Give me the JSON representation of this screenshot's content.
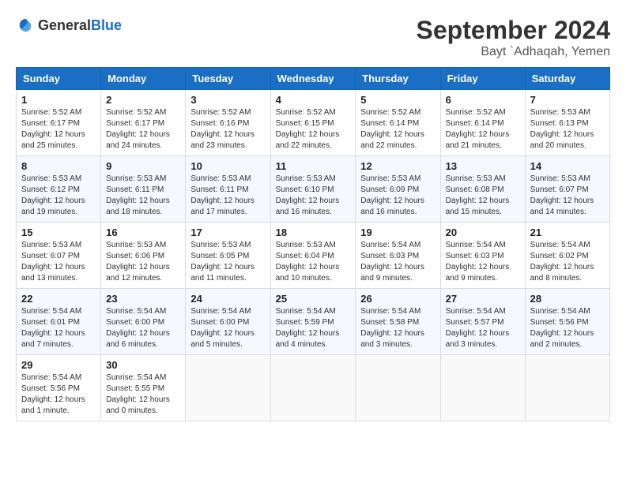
{
  "header": {
    "logo_general": "General",
    "logo_blue": "Blue",
    "month": "September 2024",
    "location": "Bayt `Adhaqah, Yemen"
  },
  "weekdays": [
    "Sunday",
    "Monday",
    "Tuesday",
    "Wednesday",
    "Thursday",
    "Friday",
    "Saturday"
  ],
  "weeks": [
    [
      {
        "day": "1",
        "sunrise": "5:52 AM",
        "sunset": "6:17 PM",
        "daylight": "12 hours and 25 minutes."
      },
      {
        "day": "2",
        "sunrise": "5:52 AM",
        "sunset": "6:17 PM",
        "daylight": "12 hours and 24 minutes."
      },
      {
        "day": "3",
        "sunrise": "5:52 AM",
        "sunset": "6:16 PM",
        "daylight": "12 hours and 23 minutes."
      },
      {
        "day": "4",
        "sunrise": "5:52 AM",
        "sunset": "6:15 PM",
        "daylight": "12 hours and 22 minutes."
      },
      {
        "day": "5",
        "sunrise": "5:52 AM",
        "sunset": "6:14 PM",
        "daylight": "12 hours and 22 minutes."
      },
      {
        "day": "6",
        "sunrise": "5:52 AM",
        "sunset": "6:14 PM",
        "daylight": "12 hours and 21 minutes."
      },
      {
        "day": "7",
        "sunrise": "5:53 AM",
        "sunset": "6:13 PM",
        "daylight": "12 hours and 20 minutes."
      }
    ],
    [
      {
        "day": "8",
        "sunrise": "5:53 AM",
        "sunset": "6:12 PM",
        "daylight": "12 hours and 19 minutes."
      },
      {
        "day": "9",
        "sunrise": "5:53 AM",
        "sunset": "6:11 PM",
        "daylight": "12 hours and 18 minutes."
      },
      {
        "day": "10",
        "sunrise": "5:53 AM",
        "sunset": "6:11 PM",
        "daylight": "12 hours and 17 minutes."
      },
      {
        "day": "11",
        "sunrise": "5:53 AM",
        "sunset": "6:10 PM",
        "daylight": "12 hours and 16 minutes."
      },
      {
        "day": "12",
        "sunrise": "5:53 AM",
        "sunset": "6:09 PM",
        "daylight": "12 hours and 16 minutes."
      },
      {
        "day": "13",
        "sunrise": "5:53 AM",
        "sunset": "6:08 PM",
        "daylight": "12 hours and 15 minutes."
      },
      {
        "day": "14",
        "sunrise": "5:53 AM",
        "sunset": "6:07 PM",
        "daylight": "12 hours and 14 minutes."
      }
    ],
    [
      {
        "day": "15",
        "sunrise": "5:53 AM",
        "sunset": "6:07 PM",
        "daylight": "12 hours and 13 minutes."
      },
      {
        "day": "16",
        "sunrise": "5:53 AM",
        "sunset": "6:06 PM",
        "daylight": "12 hours and 12 minutes."
      },
      {
        "day": "17",
        "sunrise": "5:53 AM",
        "sunset": "6:05 PM",
        "daylight": "12 hours and 11 minutes."
      },
      {
        "day": "18",
        "sunrise": "5:53 AM",
        "sunset": "6:04 PM",
        "daylight": "12 hours and 10 minutes."
      },
      {
        "day": "19",
        "sunrise": "5:54 AM",
        "sunset": "6:03 PM",
        "daylight": "12 hours and 9 minutes."
      },
      {
        "day": "20",
        "sunrise": "5:54 AM",
        "sunset": "6:03 PM",
        "daylight": "12 hours and 9 minutes."
      },
      {
        "day": "21",
        "sunrise": "5:54 AM",
        "sunset": "6:02 PM",
        "daylight": "12 hours and 8 minutes."
      }
    ],
    [
      {
        "day": "22",
        "sunrise": "5:54 AM",
        "sunset": "6:01 PM",
        "daylight": "12 hours and 7 minutes."
      },
      {
        "day": "23",
        "sunrise": "5:54 AM",
        "sunset": "6:00 PM",
        "daylight": "12 hours and 6 minutes."
      },
      {
        "day": "24",
        "sunrise": "5:54 AM",
        "sunset": "6:00 PM",
        "daylight": "12 hours and 5 minutes."
      },
      {
        "day": "25",
        "sunrise": "5:54 AM",
        "sunset": "5:59 PM",
        "daylight": "12 hours and 4 minutes."
      },
      {
        "day": "26",
        "sunrise": "5:54 AM",
        "sunset": "5:58 PM",
        "daylight": "12 hours and 3 minutes."
      },
      {
        "day": "27",
        "sunrise": "5:54 AM",
        "sunset": "5:57 PM",
        "daylight": "12 hours and 3 minutes."
      },
      {
        "day": "28",
        "sunrise": "5:54 AM",
        "sunset": "5:56 PM",
        "daylight": "12 hours and 2 minutes."
      }
    ],
    [
      {
        "day": "29",
        "sunrise": "5:54 AM",
        "sunset": "5:56 PM",
        "daylight": "12 hours and 1 minute."
      },
      {
        "day": "30",
        "sunrise": "5:54 AM",
        "sunset": "5:55 PM",
        "daylight": "12 hours and 0 minutes."
      },
      null,
      null,
      null,
      null,
      null
    ]
  ]
}
